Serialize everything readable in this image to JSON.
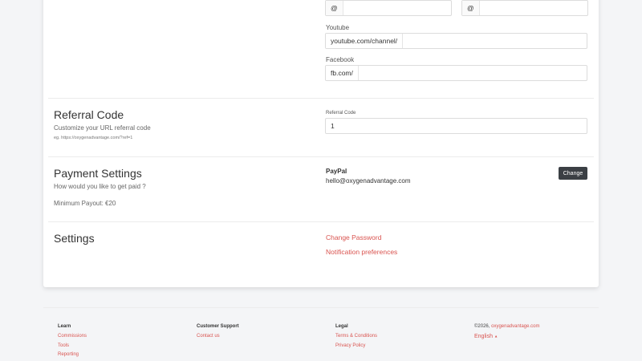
{
  "social": {
    "at_symbol": "@",
    "youtube_label": "Youtube",
    "youtube_value": "youtube.com/channel/",
    "facebook_label": "Facebook",
    "facebook_value": "fb.com/"
  },
  "referral": {
    "title": "Referral Code",
    "description": "Customize your URL referral code",
    "example": "eg. https://oxygenadvantage.com/?ref=1",
    "field_label": "Referral Code",
    "field_value": "1"
  },
  "payment": {
    "title": "Payment Settings",
    "description": "How would you like to get paid ?",
    "minimum": "Minimum Payout: €20",
    "method": "PayPal",
    "email": "hello@oxygenadvantage.com",
    "change_button": "Change"
  },
  "settings": {
    "title": "Settings",
    "change_password": "Change Password",
    "notifications": "Notification preferences"
  },
  "footer": {
    "learn": {
      "heading": "Learn",
      "links": [
        "Commissions",
        "Tools",
        "Reporting"
      ]
    },
    "support": {
      "heading": "Customer Support",
      "links": [
        "Contact us"
      ]
    },
    "legal": {
      "heading": "Legal",
      "links": [
        "Terms & Conditions",
        "Privacy Policy"
      ]
    },
    "copyright_prefix": "©2026,",
    "copyright_link": "oxygenadvantage.com",
    "language": "English",
    "language_arrow": "▲"
  },
  "colors": {
    "accent": "#d9534f",
    "button": "#3b3f44"
  }
}
